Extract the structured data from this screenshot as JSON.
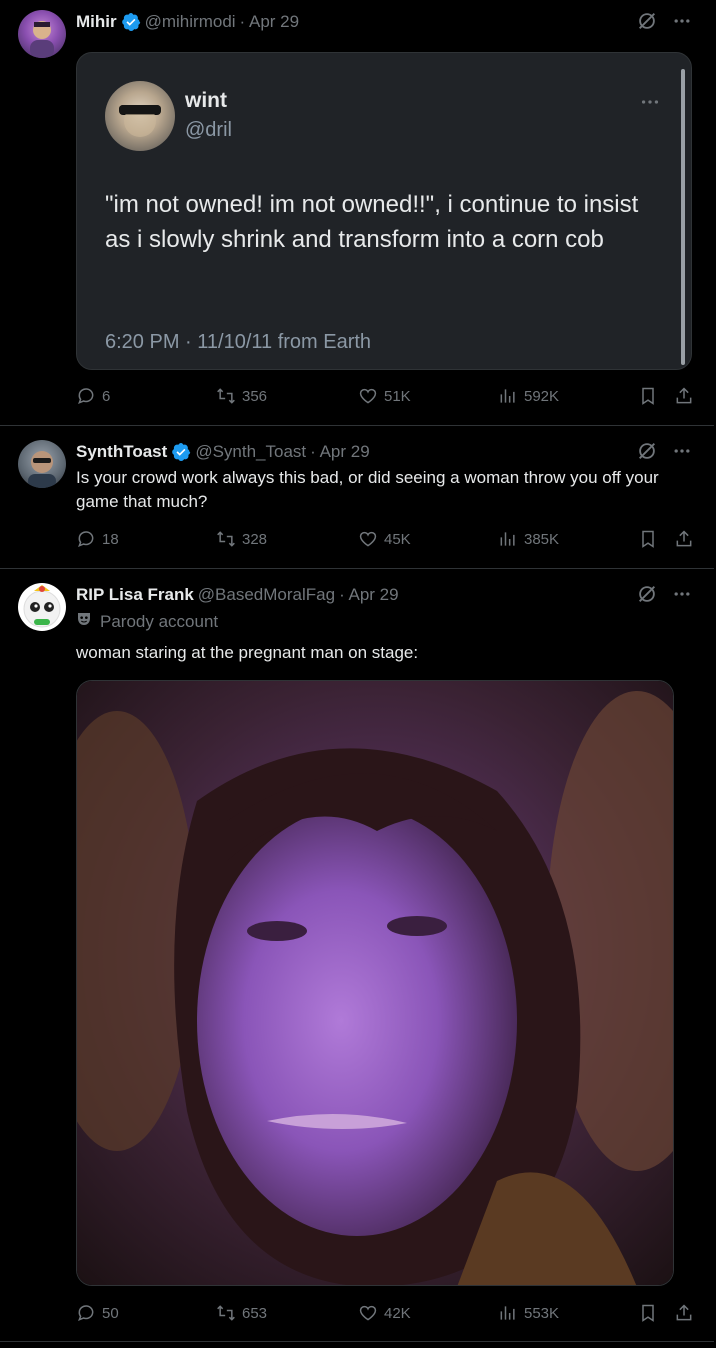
{
  "colors": {
    "accent": "#1d9bf0",
    "muted": "#71767b",
    "card": "#202327"
  },
  "tweets": [
    {
      "name": "Mihir",
      "handle": "@mihirmodi",
      "date": "· Apr 29",
      "verified": true,
      "quote": {
        "name": "wint",
        "handle": "@dril",
        "text": "\"im not owned!  im not owned!!\", i continue to insist as i slowly shrink and transform into a corn cob",
        "meta": "6:20 PM · 11/10/11 from Earth"
      },
      "stats": {
        "replies": "6",
        "retweets": "356",
        "likes": "51K",
        "views": "592K"
      }
    },
    {
      "name": "SynthToast",
      "handle": "@Synth_Toast",
      "date": "· Apr 29",
      "verified": true,
      "text": "Is your crowd work always this bad, or did seeing a woman throw you off your game that much?",
      "stats": {
        "replies": "18",
        "retweets": "328",
        "likes": "45K",
        "views": "385K"
      }
    },
    {
      "name": "RIP Lisa Frank",
      "handle": "@BasedMoralFag",
      "date": "· Apr 29",
      "verified": false,
      "parody_label": "Parody account",
      "text": "woman staring at the pregnant man on stage:",
      "stats": {
        "replies": "50",
        "retweets": "653",
        "likes": "42K",
        "views": "553K"
      }
    }
  ],
  "icons": [
    "grok-icon",
    "more-icon",
    "reply-icon",
    "retweet-icon",
    "like-icon",
    "views-icon",
    "bookmark-icon",
    "share-icon",
    "verified-badge-icon",
    "parody-mask-icon"
  ]
}
